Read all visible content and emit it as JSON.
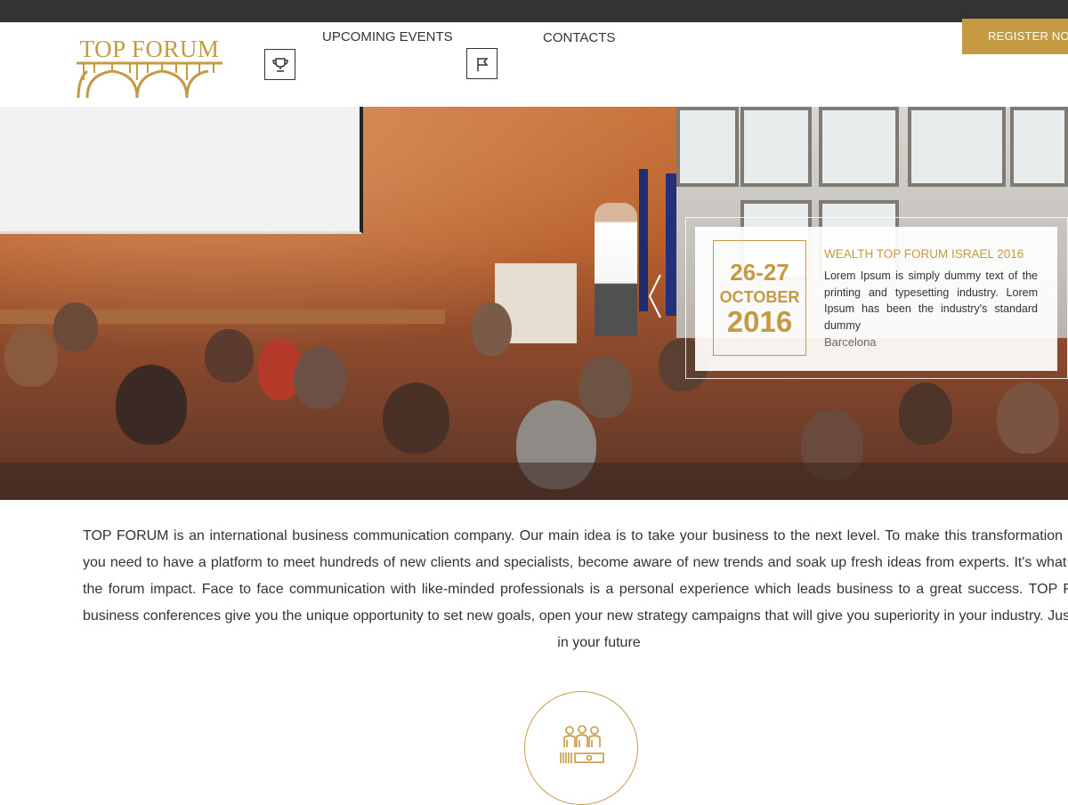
{
  "colors": {
    "accent": "#c49a43",
    "topbar": "#333333",
    "text": "#333333"
  },
  "logo": {
    "text": "TOP FORUM"
  },
  "nav": {
    "items": [
      {
        "label": "UPCOMING EVENTS",
        "icon": "trophy-icon"
      },
      {
        "label": "CONTACTS",
        "icon": "flag-icon"
      }
    ]
  },
  "register_button": {
    "label": "REGISTER NOW"
  },
  "hero": {
    "event": {
      "days": "26-27",
      "month": "OCTOBER",
      "year": "2016",
      "title": "WEALTH TOP FORUM ISRAEL 2016",
      "description": "Lorem Ipsum is simply dummy text of the printing and typesetting industry. Lorem Ipsum has been the industry's standard dummy",
      "location": "Barcelona"
    },
    "prev_icon": "chevron-left-icon"
  },
  "about": {
    "text": "TOP FORUM is an international business communication company. Our main idea is to take your business to the next level. To make this transformation happen you need to have a platform to meet hundreds of new clients and specialists, become aware of new trends and soak up fresh ideas from experts. It's what we call the forum impact. Face to face communication with like-minded professionals is a personal experience which leads business to a great success. TOP FORUM business conferences give you the unique opportunity to set new goals, open your new strategy campaigns that will give you superiority in your industry. Just invest in your future"
  },
  "feature_icon": "conference-table-icon"
}
